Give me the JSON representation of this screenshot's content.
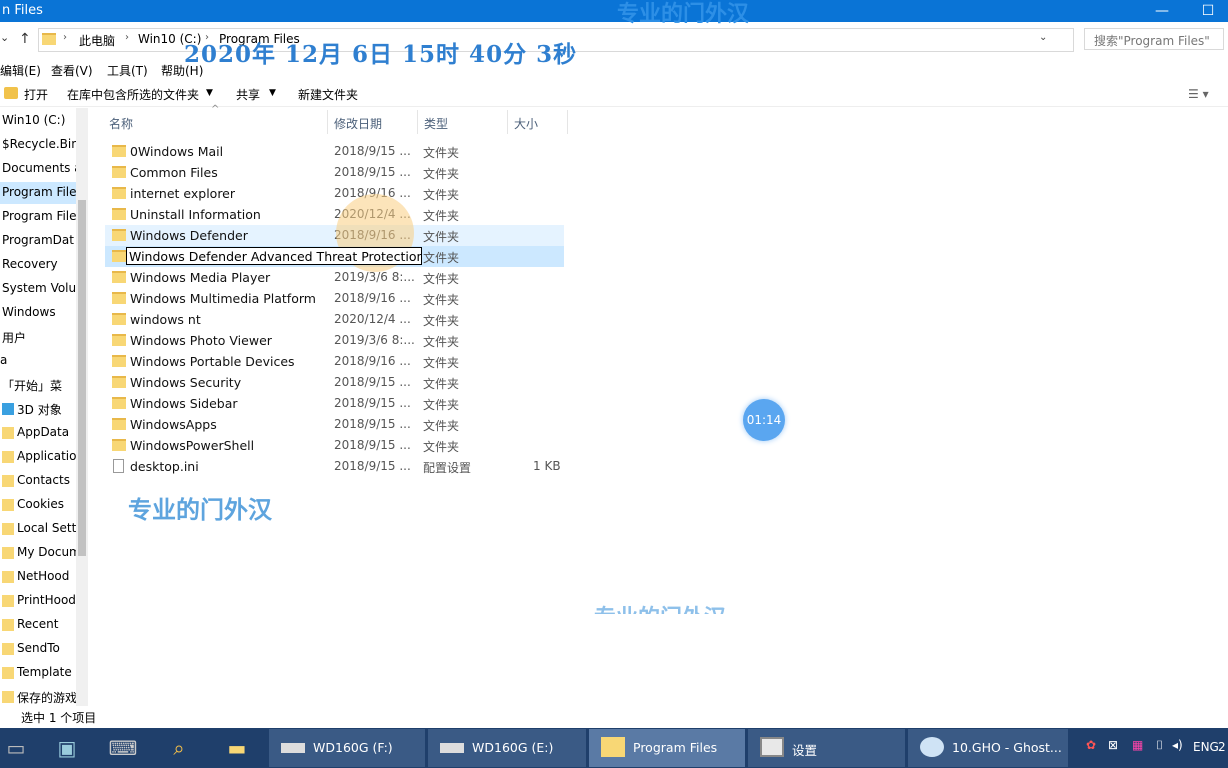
{
  "window": {
    "title": "n Files",
    "watermark": "专业的门外汉",
    "minimize": "—",
    "maximize": "☐"
  },
  "address": {
    "crumbs": [
      "此电脑",
      "Win10 (C:)",
      "Program Files"
    ],
    "search_placeholder": "搜索\"Program Files\"",
    "refresh": "⟳",
    "dropdown": "⌄"
  },
  "overlay": {
    "timestamp": "2020年 12月 6日 15时 40分 3秒",
    "watermark_main": "专业的门外汉",
    "watermark_faint": "专业的门外汉",
    "timer": "01:14"
  },
  "menu": [
    "编辑(E)",
    "查看(V)",
    "工具(T)",
    "帮助(H)"
  ],
  "toolbar": {
    "open": "打开",
    "include_library": "在库中包含所选的文件夹",
    "share": "共享",
    "new_folder": "新建文件夹",
    "arrow": "▼"
  },
  "sidebar": [
    "Win10 (C:)",
    "$Recycle.Bin",
    "Documents a",
    "Program File",
    "Program File",
    "ProgramDat",
    "Recovery",
    "System Volu",
    "Windows",
    "用户",
    "a",
    "「开始」菜",
    "3D 对象",
    "AppData",
    "Applicatio",
    "Contacts",
    "Cookies",
    "Local Setti",
    "My Docum",
    "NetHood",
    "PrintHood",
    "Recent",
    "SendTo",
    "Template",
    "保存的游戏"
  ],
  "columns": {
    "name": "名称",
    "date": "修改日期",
    "type": "类型",
    "size": "大小"
  },
  "files": [
    {
      "name": "0Windows Mail",
      "date": "2018/9/15 ...",
      "type": "文件夹",
      "size": ""
    },
    {
      "name": "Common Files",
      "date": "2018/9/15 ...",
      "type": "文件夹",
      "size": ""
    },
    {
      "name": "internet explorer",
      "date": "2018/9/16 ...",
      "type": "文件夹",
      "size": ""
    },
    {
      "name": "Uninstall Information",
      "date": "2020/12/4 ...",
      "type": "文件夹",
      "size": ""
    },
    {
      "name": "Windows Defender",
      "date": "2018/9/16 ...",
      "type": "文件夹",
      "size": ""
    },
    {
      "name": "Windows Defender Advanced Threat Protection",
      "date": "",
      "type": "文件夹",
      "size": ""
    },
    {
      "name": "Windows Media Player",
      "date": "2019/3/6 8:...",
      "type": "文件夹",
      "size": ""
    },
    {
      "name": "Windows Multimedia Platform",
      "date": "2018/9/16 ...",
      "type": "文件夹",
      "size": ""
    },
    {
      "name": "windows nt",
      "date": "2020/12/4 ...",
      "type": "文件夹",
      "size": ""
    },
    {
      "name": "Windows Photo Viewer",
      "date": "2019/3/6 8:...",
      "type": "文件夹",
      "size": ""
    },
    {
      "name": "Windows Portable Devices",
      "date": "2018/9/16 ...",
      "type": "文件夹",
      "size": ""
    },
    {
      "name": "Windows Security",
      "date": "2018/9/15 ...",
      "type": "文件夹",
      "size": ""
    },
    {
      "name": "Windows Sidebar",
      "date": "2018/9/15 ...",
      "type": "文件夹",
      "size": ""
    },
    {
      "name": "WindowsApps",
      "date": "2018/9/15 ...",
      "type": "文件夹",
      "size": ""
    },
    {
      "name": "WindowsPowerShell",
      "date": "2018/9/15 ...",
      "type": "文件夹",
      "size": ""
    },
    {
      "name": "desktop.ini",
      "date": "2018/9/15 ...",
      "type": "配置设置",
      "size": "1 KB"
    }
  ],
  "rename_value": "Windows Defender Advanced Threat Protection",
  "status": {
    "selected": "选中 1 个项目"
  },
  "taskbar": {
    "buttons": [
      "WD160G (F:)",
      "WD160G (E:)",
      "Program Files",
      "设置",
      "10.GHO - Ghost..."
    ],
    "tray_lang": "ENG",
    "tray_clock": "2"
  }
}
